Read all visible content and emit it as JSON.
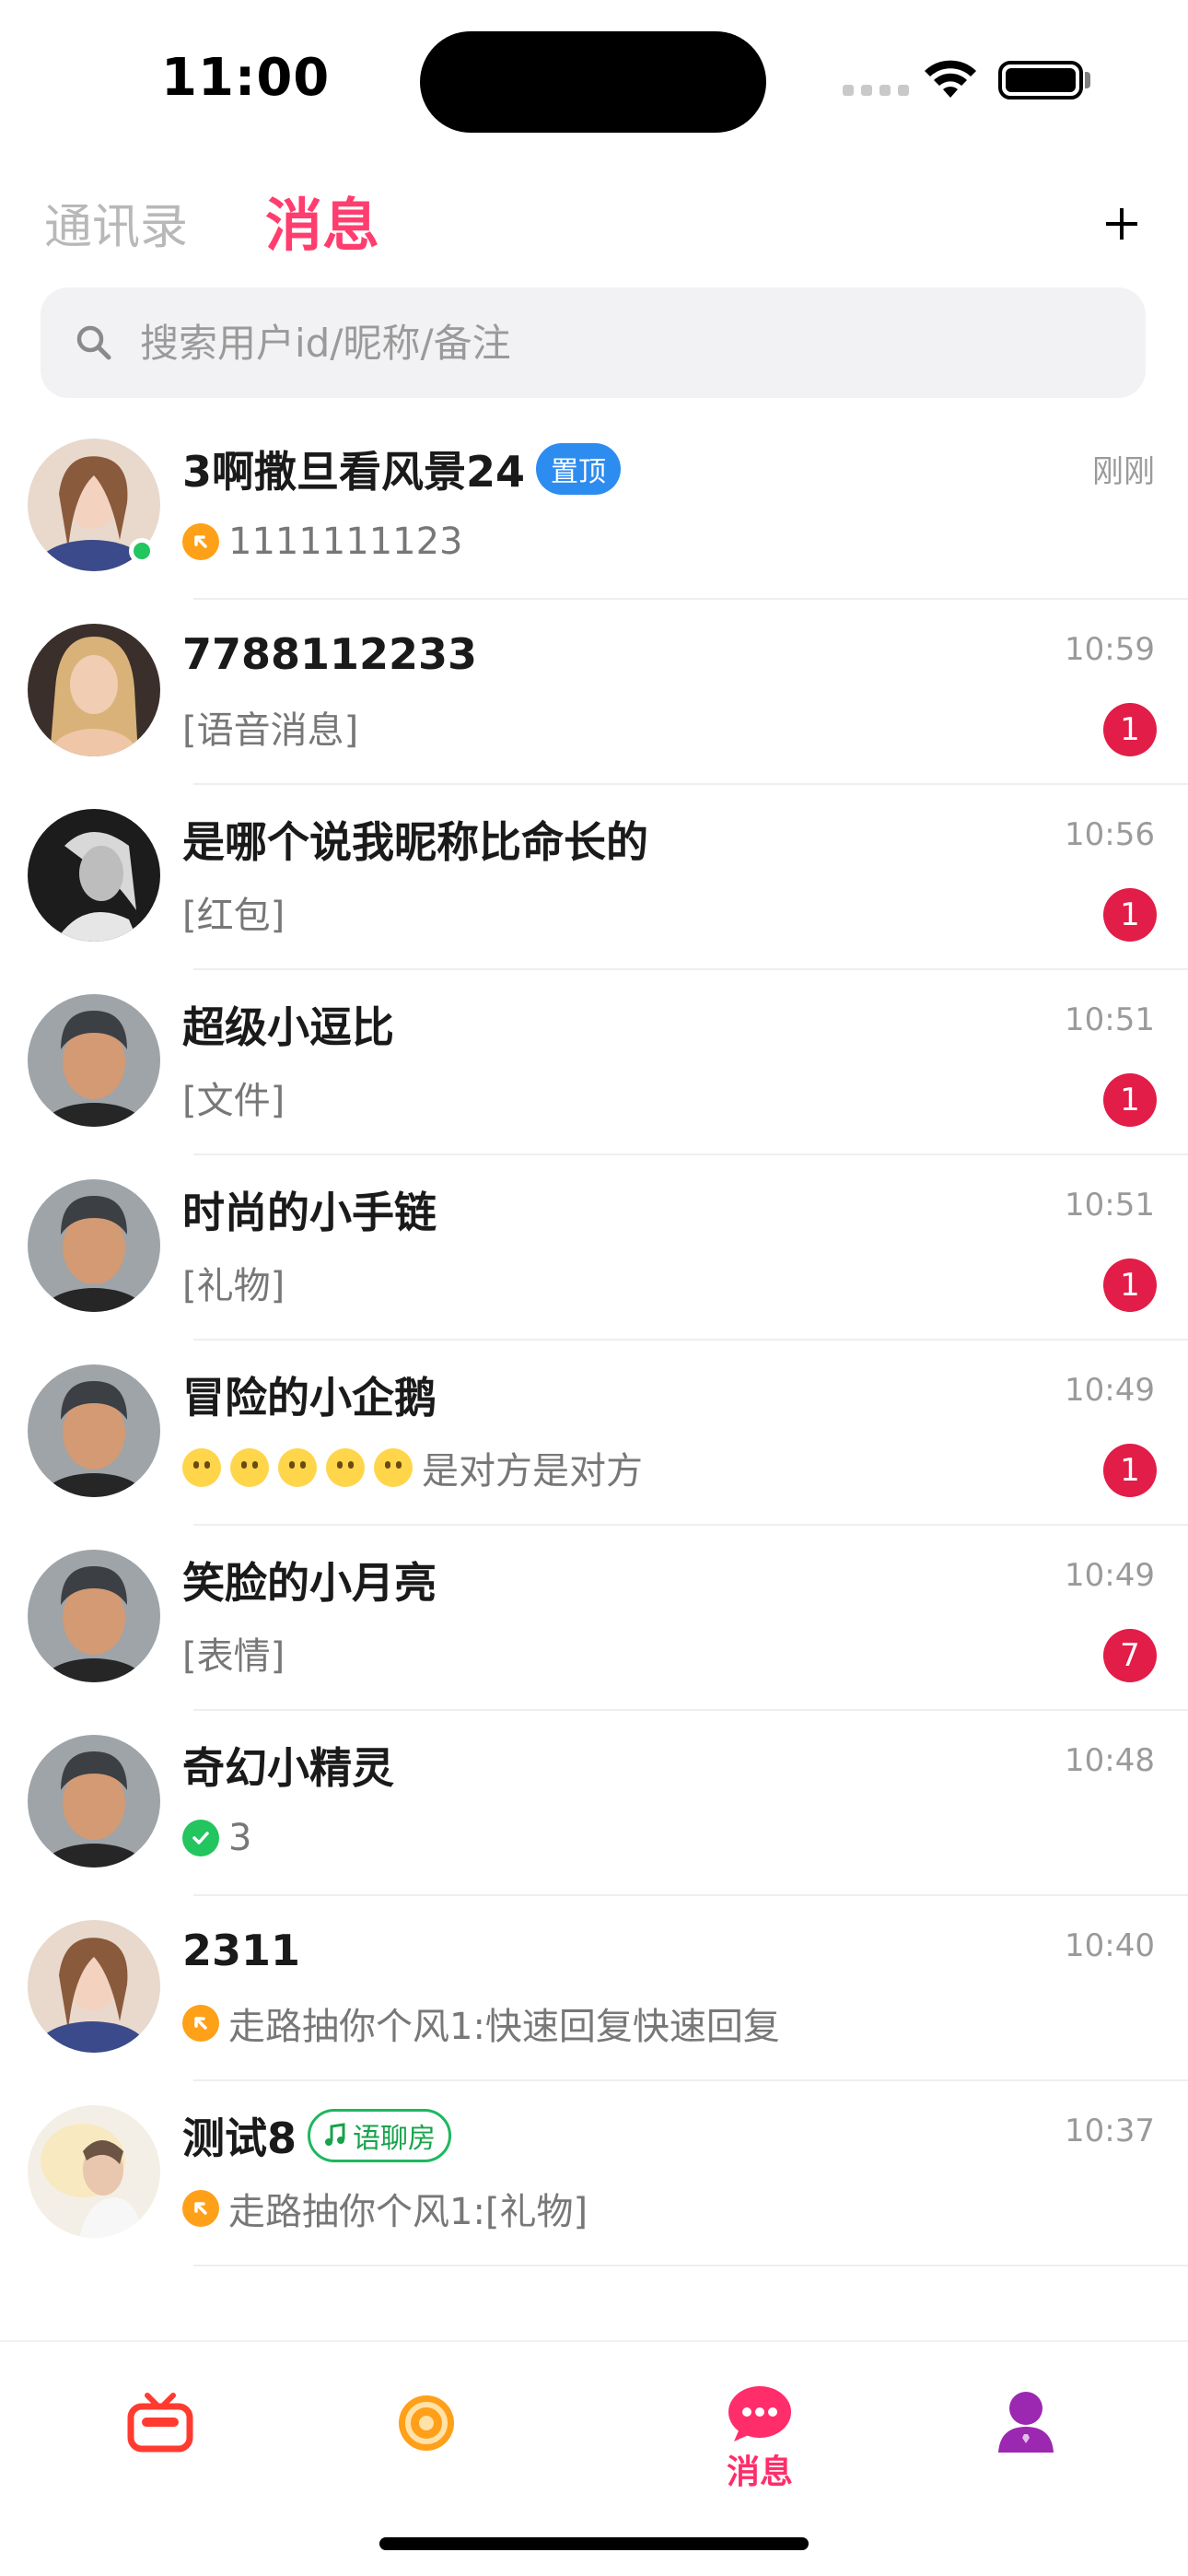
{
  "status_bar": {
    "time": "11:00"
  },
  "header": {
    "tab_contacts": "通讯录",
    "tab_messages": "消息",
    "add_icon": "plus-icon"
  },
  "search": {
    "placeholder": "搜索用户id/昵称/备注"
  },
  "colors": {
    "accent": "#ff3d6e",
    "unread": "#e11d48",
    "pinned": "#2d8cf0",
    "voice_room": "#16a34a",
    "online": "#22c55e"
  },
  "conversations": [
    {
      "name": "3啊撒旦看风景24",
      "badge": "置顶",
      "time": "刚刚",
      "preview": "1111111123",
      "preview_icon": "orange-arrow-icon",
      "online": true
    },
    {
      "name": "7788112233",
      "time": "10:59",
      "preview": "[语音消息]",
      "unread": "1"
    },
    {
      "name": "是哪个说我昵称比命长的",
      "time": "10:56",
      "preview": "[红包]",
      "unread": "1"
    },
    {
      "name": "超级小逗比",
      "time": "10:51",
      "preview": "[文件]",
      "unread": "1"
    },
    {
      "name": "时尚的小手链",
      "time": "10:51",
      "preview": "[礼物]",
      "unread": "1"
    },
    {
      "name": "冒险的小企鹅",
      "time": "10:49",
      "preview": "是对方是对方",
      "emoji_count": 5,
      "unread": "1"
    },
    {
      "name": "笑脸的小月亮",
      "time": "10:49",
      "preview": "[表情]",
      "unread": "7"
    },
    {
      "name": "奇幻小精灵",
      "time": "10:48",
      "preview": "3",
      "preview_icon": "green-check-icon"
    },
    {
      "name": "2311",
      "time": "10:40",
      "preview": "走路抽你个风1:快速回复快速回复",
      "preview_icon": "orange-arrow-icon"
    },
    {
      "name": "测试8",
      "voice_badge": "语聊房",
      "time": "10:37",
      "preview": "走路抽你个风1:[礼物]",
      "preview_icon": "orange-arrow-icon"
    }
  ],
  "tabbar": {
    "tab_messages_label": "消息"
  }
}
